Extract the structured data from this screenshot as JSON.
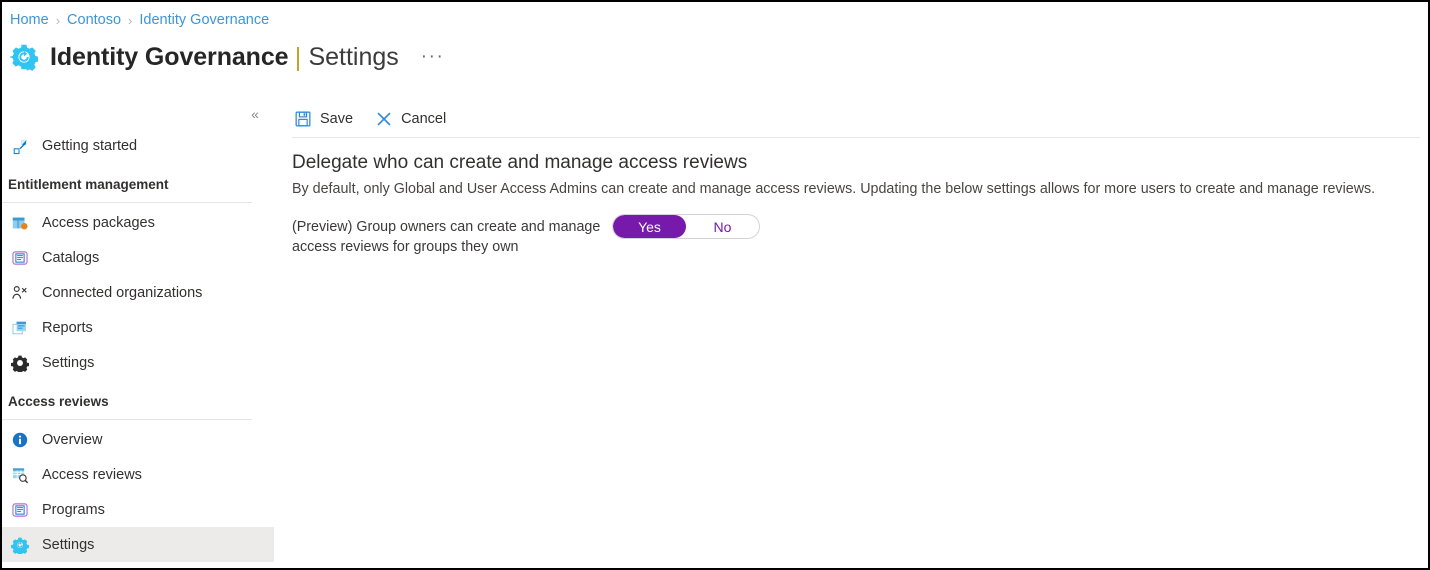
{
  "breadcrumb": {
    "items": [
      "Home",
      "Contoso",
      "Identity Governance"
    ],
    "separator": "›"
  },
  "header": {
    "icon": "identity-governance-gear-icon",
    "title": "Identity Governance",
    "subtitle": "Settings",
    "more_menu": "···"
  },
  "sidebar": {
    "collapse_icon": "«",
    "top_items": [
      {
        "label": "Getting started",
        "icon": "rocket-icon",
        "selected": false
      }
    ],
    "sections": [
      {
        "title": "Entitlement management",
        "items": [
          {
            "label": "Access packages",
            "icon": "package-icon",
            "selected": false
          },
          {
            "label": "Catalogs",
            "icon": "book-icon",
            "selected": false
          },
          {
            "label": "Connected organizations",
            "icon": "people-icon",
            "selected": false
          },
          {
            "label": "Reports",
            "icon": "report-icon",
            "selected": false
          },
          {
            "label": "Settings",
            "icon": "gear-dark-icon",
            "selected": false
          }
        ]
      },
      {
        "title": "Access reviews",
        "items": [
          {
            "label": "Overview",
            "icon": "info-circle-icon",
            "selected": false
          },
          {
            "label": "Access reviews",
            "icon": "review-search-icon",
            "selected": false
          },
          {
            "label": "Programs",
            "icon": "book-icon",
            "selected": false
          },
          {
            "label": "Settings",
            "icon": "gear-cyan-icon",
            "selected": true
          }
        ]
      }
    ]
  },
  "toolbar": {
    "save_label": "Save",
    "cancel_label": "Cancel",
    "save_icon": "save-floppy-icon",
    "cancel_icon": "close-x-icon"
  },
  "main": {
    "heading": "Delegate who can create and manage access reviews",
    "description": "By default, only Global and User Access Admins can create and manage access reviews. Updating the below settings allows for more users to create and manage reviews.",
    "setting": {
      "label": "(Preview) Group owners can create and manage access reviews for groups they own",
      "toggle": {
        "on_label": "Yes",
        "off_label": "No",
        "value": "Yes"
      }
    }
  },
  "colors": {
    "link_blue": "#3b96d9",
    "accent_purple": "#7719aa",
    "azure_blue": "#0078d4",
    "cyan": "#30c4f0",
    "selected_bg": "#edebe9"
  }
}
